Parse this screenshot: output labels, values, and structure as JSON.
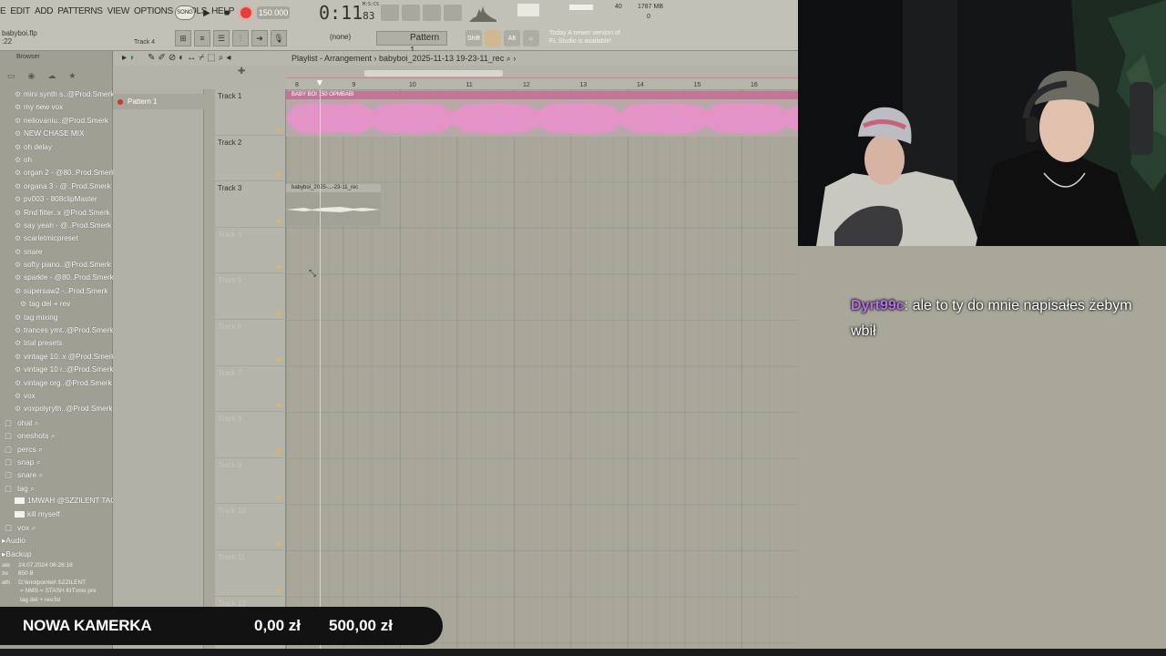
{
  "menu": [
    "E",
    "EDIT",
    "ADD",
    "PATTERNS",
    "VIEW",
    "OPTIONS",
    "TOOLS",
    "HELP"
  ],
  "file": {
    "name": "babyboi.flp",
    "time": ":22",
    "track_hint": "Track 4"
  },
  "transport": {
    "mode": "SONG",
    "tempo": "150.000",
    "time_main": "0:11",
    "time_small": "83",
    "time_unit": "M:S:CS"
  },
  "cpu": {
    "value": "40",
    "memory": "1787 MB",
    "voices": "0"
  },
  "toolbar2": {
    "snap": "(none)",
    "pattern": "Pattern 1",
    "key_shift": "Shift",
    "key_alt": "Alt"
  },
  "news": {
    "line1": "Today  A newer version of",
    "line2": "FL Studio is available!"
  },
  "browser": {
    "title": "Browser",
    "items": [
      {
        "type": "preset",
        "label": "mini synth s..@Prod.Smerk"
      },
      {
        "type": "preset",
        "label": "my new vox"
      },
      {
        "type": "preset",
        "label": "neliovaniu..@Prod.Smerk"
      },
      {
        "type": "preset",
        "label": "NEW CHASE MIX"
      },
      {
        "type": "preset",
        "label": "oh delay"
      },
      {
        "type": "preset",
        "label": "oh"
      },
      {
        "type": "preset",
        "label": "organ 2 - @80..Prod.Smerk"
      },
      {
        "type": "preset",
        "label": "organa 3 - @..Prod.Smerk"
      },
      {
        "type": "preset",
        "label": "pv003 - 808clipMaster"
      },
      {
        "type": "preset",
        "label": "Rnd filter..x @Prod.Smerk"
      },
      {
        "type": "preset",
        "label": "say yeah - @..Prod.Smerk"
      },
      {
        "type": "preset",
        "label": "scarletmicpreset"
      },
      {
        "type": "preset",
        "label": "snare"
      },
      {
        "type": "preset",
        "label": "softy piano..@Prod.Smerk"
      },
      {
        "type": "preset",
        "label": "sparkle - @80..Prod.Smerk"
      },
      {
        "type": "preset",
        "label": "supersaw2 -..Prod.Smerk"
      },
      {
        "type": "sub",
        "label": "tag del + rev"
      },
      {
        "type": "preset",
        "label": "tag mixing"
      },
      {
        "type": "preset",
        "label": "trances ymt..@Prod.Smerk"
      },
      {
        "type": "preset",
        "label": "trial presets"
      },
      {
        "type": "preset",
        "label": "vintage 10..x @Prod.Smerk"
      },
      {
        "type": "preset",
        "label": "vintage 10 r..@Prod.Smerk"
      },
      {
        "type": "preset",
        "label": "vintage org..@Prod.Smerk"
      },
      {
        "type": "preset",
        "label": "vox"
      },
      {
        "type": "preset",
        "label": "voxpolyryth..@Prod.Smerk"
      },
      {
        "type": "folder",
        "label": "ohat"
      },
      {
        "type": "folder",
        "label": "oneshots"
      },
      {
        "type": "folder",
        "label": "percs"
      },
      {
        "type": "folder",
        "label": "snap"
      },
      {
        "type": "folder",
        "label": "snare"
      },
      {
        "type": "folder",
        "label": "tag"
      },
      {
        "type": "audio",
        "label": "1MWAH @SZZILENT TAG"
      },
      {
        "type": "audio",
        "label": "kill myself"
      },
      {
        "type": "folder",
        "label": "vox"
      },
      {
        "type": "section",
        "label": "Audio"
      },
      {
        "type": "section",
        "label": "Backup"
      }
    ],
    "footer": {
      "date_label": "ate",
      "date": "24.07.2024 06:26:18",
      "size_label": "ze",
      "size": "850 B",
      "path_label": "ath",
      "path1": "D:\\knotpointel\\ SZZILENT",
      "path2": "= NMS = STASH KIT\\mix pre",
      "path3": "tag del + rev.fst"
    }
  },
  "pattern_panel": {
    "item": "Pattern 1"
  },
  "playlist": {
    "title": "Playlist - Arrangement",
    "project": "babyboi_2025-11-13 19-23-11_rec",
    "ruler": [
      "8",
      "9",
      "10",
      "11",
      "12",
      "13",
      "14",
      "15",
      "16"
    ],
    "tracks": [
      "Track 1",
      "Track 2",
      "Track 3",
      "Track 4",
      "Track 5",
      "Track 6",
      "Track 7",
      "Track 8",
      "Track 9",
      "Track 10",
      "Track 11",
      "Track 12"
    ],
    "clip1": "BABY BOI 150 OPMBABI",
    "clip3": "babyboi_2025-...-23-11_rec"
  },
  "chat": {
    "user": "Dyrt99c",
    "message": ": ale to ty do mnie napisałes żebym wbił"
  },
  "donation": {
    "title": "NOWA KAMERKA",
    "current": "0,00 zł",
    "goal": "500,00 zł"
  },
  "colors": {
    "clip_pink": "#c47496",
    "record_red": "#e0403a",
    "chat_user": "#b36ee8",
    "fl_bg": "#a8a79a"
  }
}
